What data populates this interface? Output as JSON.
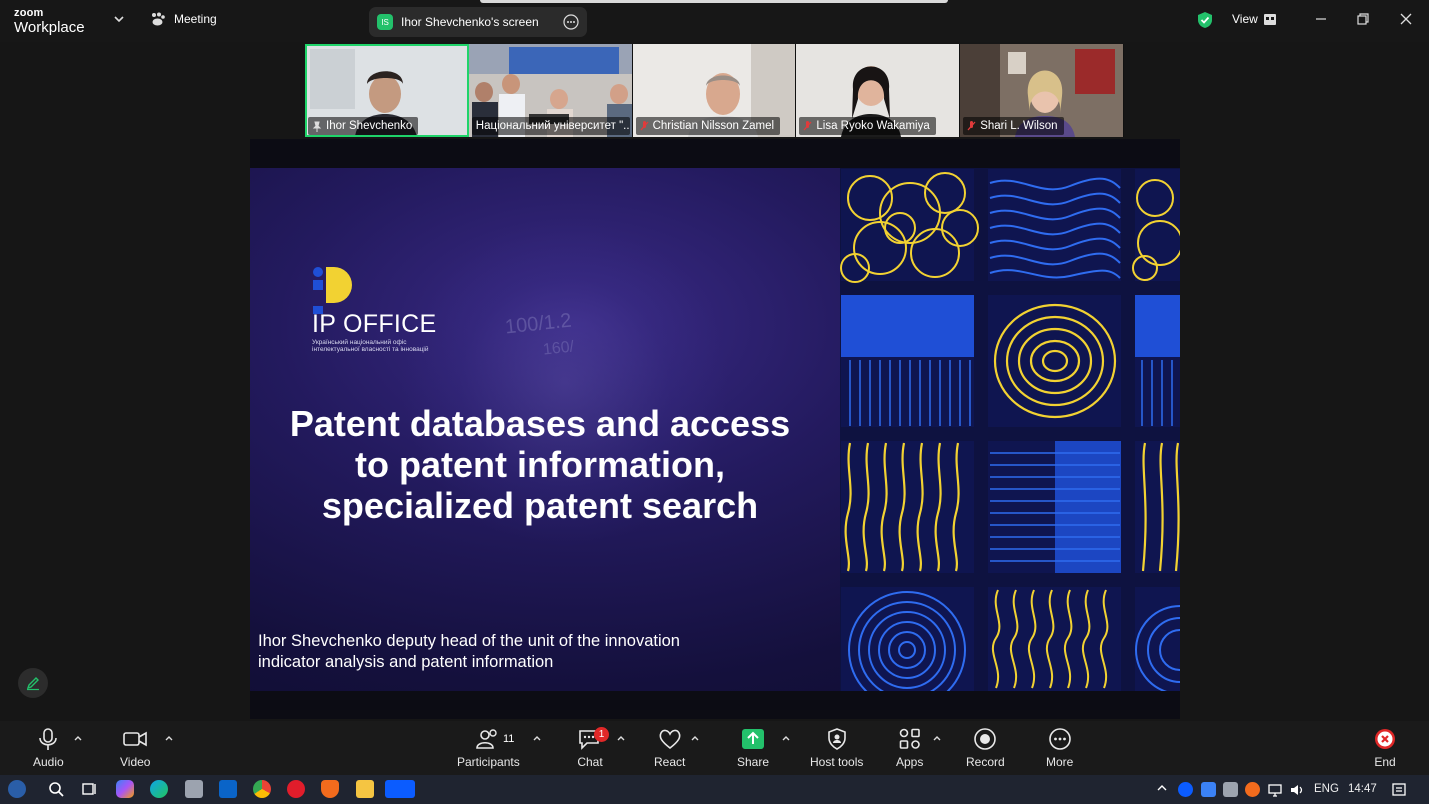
{
  "app": {
    "brand_line1": "zoom",
    "brand_line2": "Workplace",
    "meeting_label": "Meeting"
  },
  "share_pill": {
    "initials": "IS",
    "label": "Ihor Shevchenko's screen"
  },
  "top_right": {
    "view_label": "View"
  },
  "participants_strip": [
    {
      "name": "Ihor Shevchenko",
      "status": "pinned",
      "active": true
    },
    {
      "name": "Національний університет \"...",
      "status": "none",
      "active": false
    },
    {
      "name": "Christian Nilsson Zamel",
      "status": "muted",
      "active": false
    },
    {
      "name": "Lisa Ryoko Wakamiya",
      "status": "muted",
      "active": false
    },
    {
      "name": "Shari  L. Wilson",
      "status": "muted",
      "active": false
    }
  ],
  "slide": {
    "ghost_text_1": "100/1.2",
    "ghost_text_2": "160/",
    "logo_text": "IP OFFICE",
    "logo_subtitle_line1": "Український національний офіс",
    "logo_subtitle_line2": "інтелектуальної власності та інновацій",
    "title_line1": "Patent databases and access",
    "title_line2": "to patent information,",
    "title_line3": "specialized patent search",
    "author_line1": "Ihor Shevchenko deputy head of the unit of the innovation",
    "author_line2": "indicator analysis and patent information",
    "colors": {
      "blue": "#1f4fd6",
      "yellow": "#f2d232",
      "navy": "#0f1550"
    }
  },
  "toolbar": {
    "audio": "Audio",
    "video": "Video",
    "participants": "Participants",
    "participants_count": "11",
    "chat": "Chat",
    "chat_badge": "1",
    "react": "React",
    "share": "Share",
    "host_tools": "Host tools",
    "apps": "Apps",
    "record": "Record",
    "more": "More",
    "end": "End"
  },
  "taskbar": {
    "language": "ENG",
    "time": "14:47"
  },
  "icons": [
    "chevron-down-icon",
    "paw-icon",
    "ellipsis-icon",
    "shield-check-icon",
    "view-grid-icon",
    "minimize-icon",
    "restore-icon",
    "close-icon",
    "pin-icon",
    "mic-off-icon",
    "pencil-icon",
    "mic-icon",
    "camera-icon",
    "people-icon",
    "chat-icon",
    "heart-icon",
    "share-arrow-icon",
    "host-shield-icon",
    "apps-icon",
    "record-icon",
    "more-icon",
    "end-icon"
  ]
}
